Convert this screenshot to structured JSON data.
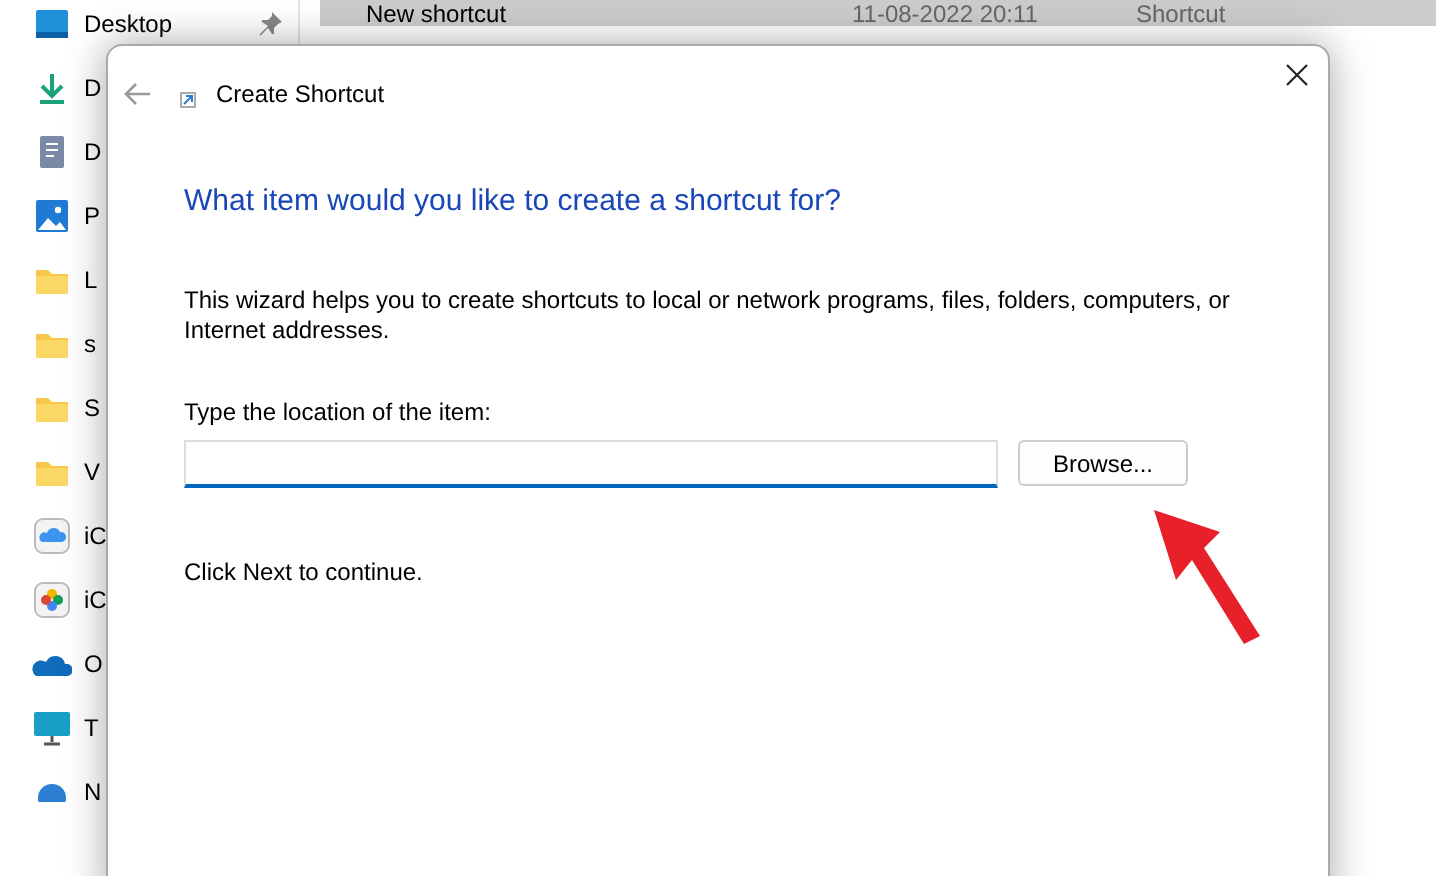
{
  "file_row": {
    "name": "New shortcut",
    "date": "11-08-2022 20:11",
    "type": "Shortcut",
    "selected": true
  },
  "sidebar": {
    "items": [
      {
        "kind": "desktop",
        "label": "Desktop"
      },
      {
        "kind": "download",
        "label": "D"
      },
      {
        "kind": "document",
        "label": "D"
      },
      {
        "kind": "picture",
        "label": "P"
      },
      {
        "kind": "folder",
        "label": "L"
      },
      {
        "kind": "folder",
        "label": "s"
      },
      {
        "kind": "folder",
        "label": "S"
      },
      {
        "kind": "folder",
        "label": "V"
      },
      {
        "kind": "cloud",
        "label": "iC"
      },
      {
        "kind": "photos",
        "label": "iC"
      },
      {
        "kind": "onedrive",
        "label": "O"
      },
      {
        "kind": "pc",
        "label": "T"
      },
      {
        "kind": "network",
        "label": "N"
      }
    ]
  },
  "dialog": {
    "title": "Create Shortcut",
    "heading": "What item would you like to create a shortcut for?",
    "description": "This wizard helps you to create shortcuts to local or network programs, files, folders, computers, or Internet addresses.",
    "field_label": "Type the location of the item:",
    "browse_button": "Browse...",
    "hint": "Click Next to continue."
  }
}
